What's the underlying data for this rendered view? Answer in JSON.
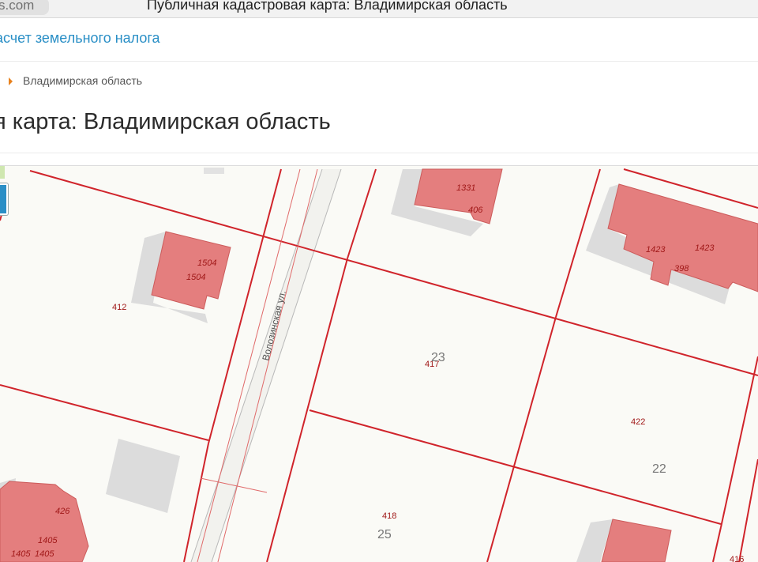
{
  "browser": {
    "url_fragment": "s.com",
    "tab_title": "Публичная кадастровая карта: Владимирская область"
  },
  "nav": {
    "link_label": "асчет земельного налога"
  },
  "breadcrumb": {
    "item": "Владимирская область"
  },
  "page": {
    "title": "я карта: Владимирская область"
  },
  "map": {
    "street_name": "Волозинская ул.",
    "labels": {
      "b1331": "1331",
      "b406": "406",
      "b1423a": "1423",
      "b1423b": "1423",
      "b398": "398",
      "b1504a": "1504",
      "b1504b": "1504",
      "p412": "412",
      "p417": "417",
      "n23": "23",
      "p422": "422",
      "n22": "22",
      "p418": "418",
      "n25": "25",
      "b426": "426",
      "b1405a": "1405",
      "b1405b": "1405",
      "b1405c": "1405",
      "p416": "416"
    },
    "colors": {
      "background": "#fafaf6",
      "parcel_border": "#d0242b",
      "building_fill": "#e47e7e",
      "shadow_fill": "#dcdcdc",
      "label": "#a01818"
    }
  }
}
